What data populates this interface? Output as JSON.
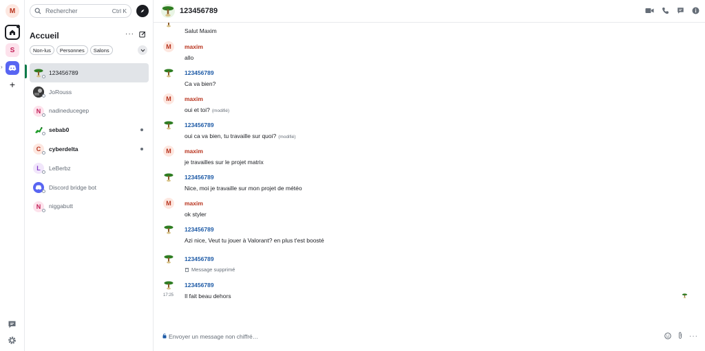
{
  "rail": {
    "user_initial": "M",
    "space_initial": "S"
  },
  "roomlist": {
    "search_placeholder": "Rechercher",
    "search_shortcut": "Ctrl K",
    "title": "Accueil",
    "filters": [
      "Non-lus",
      "Personnes",
      "Salons"
    ],
    "rooms": [
      {
        "name": "123456789",
        "initial": "",
        "selected": true,
        "unread": false
      },
      {
        "name": "JoRouss",
        "initial": "",
        "selected": false,
        "unread": false
      },
      {
        "name": "nadineducegep",
        "initial": "N",
        "selected": false,
        "unread": false
      },
      {
        "name": "sebab0",
        "initial": "",
        "selected": false,
        "unread": true
      },
      {
        "name": "cyberdelta",
        "initial": "C",
        "selected": false,
        "unread": true
      },
      {
        "name": "LeBerbz",
        "initial": "L",
        "selected": false,
        "unread": false
      },
      {
        "name": "Discord bridge bot",
        "initial": "",
        "selected": false,
        "unread": false
      },
      {
        "name": "niggabutt",
        "initial": "N",
        "selected": false,
        "unread": false
      }
    ]
  },
  "header": {
    "room_name": "123456789"
  },
  "timeline": {
    "messages": [
      {
        "sender": "",
        "body": "Salut Maxim",
        "edited": ""
      },
      {
        "sender": "maxim",
        "initial": "M",
        "body": "allo",
        "edited": ""
      },
      {
        "sender": "123456789",
        "body": "Ca va bien?",
        "edited": ""
      },
      {
        "sender": "maxim",
        "initial": "M",
        "body": "oui et toi?",
        "edited": "(modifié)"
      },
      {
        "sender": "123456789",
        "body": "oui ca va bien, tu travaille sur quoi?",
        "edited": "(modifié)"
      },
      {
        "sender": "maxim",
        "initial": "M",
        "body": "je travailles sur le projet matrix",
        "edited": ""
      },
      {
        "sender": "123456789",
        "body": "Nice, moi je travaille sur mon projet de météo",
        "edited": ""
      },
      {
        "sender": "maxim",
        "initial": "M",
        "body": "ok styler",
        "edited": ""
      },
      {
        "sender": "123456789",
        "body": "Azi nice, Veut tu jouer à Valorant? en plus t'est boosté",
        "edited": ""
      },
      {
        "sender": "123456789",
        "body": "Message supprimé",
        "edited": "",
        "deleted": true
      },
      {
        "sender": "123456789",
        "body": "Il fait beau dehors",
        "edited": "",
        "timestamp": "17:25"
      }
    ]
  },
  "composer": {
    "placeholder": "Envoyer un message non chiffré…"
  },
  "colors": {
    "accent": "#0b7a48",
    "maxim": "#b8321c",
    "other": "#1d5aa6",
    "discord": "#5865f2"
  }
}
